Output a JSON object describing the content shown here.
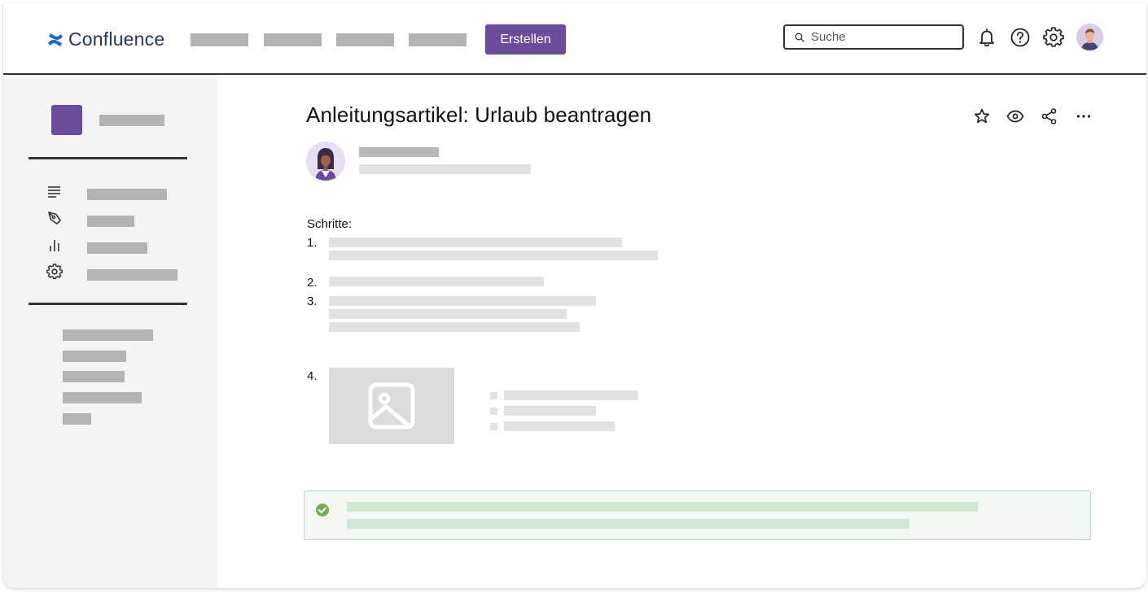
{
  "app": {
    "name": "Confluence",
    "brand_color": "#6b4c9a",
    "logo_color": "#1868db"
  },
  "header": {
    "create_label": "Erstellen",
    "search": {
      "placeholder": "Suche"
    },
    "icons": [
      "bell-icon",
      "help-icon",
      "settings-icon",
      "user-avatar"
    ]
  },
  "sidebar": {
    "nav_icons": [
      "lines-icon",
      "pen-icon",
      "bar-chart-icon",
      "gear-icon"
    ]
  },
  "page": {
    "title": "Anleitungsartikel: Urlaub beantragen",
    "steps_label": "Schritte:",
    "step_numbers": [
      "1.",
      "2.",
      "3.",
      "4."
    ],
    "actions": [
      "star-icon",
      "watch-icon",
      "share-icon",
      "more-icon"
    ],
    "success_color": "#73b04c"
  }
}
